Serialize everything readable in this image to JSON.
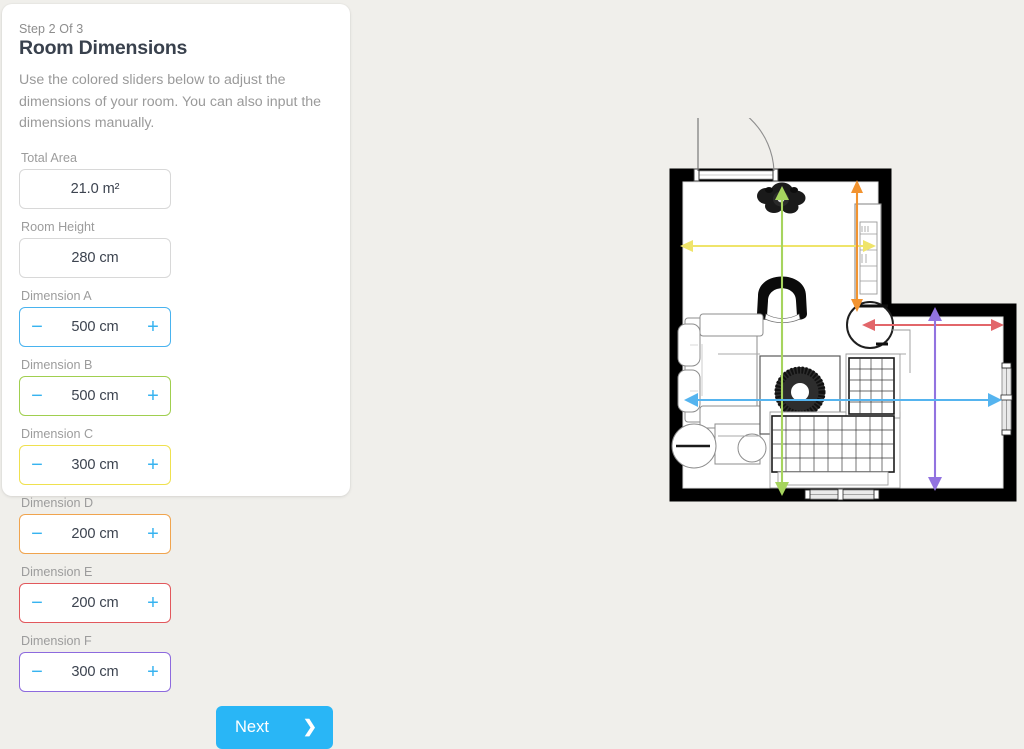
{
  "panel": {
    "step_label": "Step 2 Of 3",
    "title": "Room Dimensions",
    "description": "Use the colored sliders below to adjust the dimensions of your room. You can also input the dimensions manually.",
    "next_label": "Next",
    "next_icon": "chevron-right-icon",
    "minus_glyph": "−",
    "plus_glyph": "+",
    "readonly_fields": [
      {
        "label": "Total Area",
        "value": "21.0 m²"
      },
      {
        "label": "Room Height",
        "value": "280 cm"
      }
    ],
    "dimension_fields": [
      {
        "label": "Dimension A",
        "value": "500 cm",
        "color": "#49b3ef",
        "key": "A"
      },
      {
        "label": "Dimension B",
        "value": "500 cm",
        "color": "#a0cf4f",
        "key": "B"
      },
      {
        "label": "Dimension C",
        "value": "300 cm",
        "color": "#efe14f",
        "key": "C"
      },
      {
        "label": "Dimension D",
        "value": "200 cm",
        "color": "#f0a44e",
        "key": "D"
      },
      {
        "label": "Dimension E",
        "value": "200 cm",
        "color": "#e2585c",
        "key": "E"
      },
      {
        "label": "Dimension F",
        "value": "300 cm",
        "color": "#8d6ade",
        "key": "F"
      }
    ]
  },
  "floorplan": {
    "wall_color": "#000000",
    "floor_color": "#ffffff",
    "background": "#f0efeb",
    "dimension_arrows": [
      {
        "key": "A",
        "color": "#55b4ef",
        "orientation": "horizontal",
        "value": "500 cm"
      },
      {
        "key": "B",
        "color": "#a6d45e",
        "orientation": "vertical",
        "value": "500 cm"
      },
      {
        "key": "C",
        "color": "#efe46a",
        "orientation": "horizontal",
        "value": "300 cm"
      },
      {
        "key": "D",
        "color": "#f2932f",
        "orientation": "vertical",
        "value": "200 cm"
      },
      {
        "key": "E",
        "color": "#e2666a",
        "orientation": "horizontal",
        "value": "200 cm"
      },
      {
        "key": "F",
        "color": "#9273e0",
        "orientation": "vertical",
        "value": "300 cm"
      }
    ],
    "features": [
      "door-top-left",
      "window-right-wall",
      "window-bottom-wall",
      "plant",
      "armchair",
      "bookshelf",
      "sofa",
      "coffee-table",
      "round-rug",
      "sectional-sofa",
      "round-table",
      "side-tables"
    ]
  }
}
